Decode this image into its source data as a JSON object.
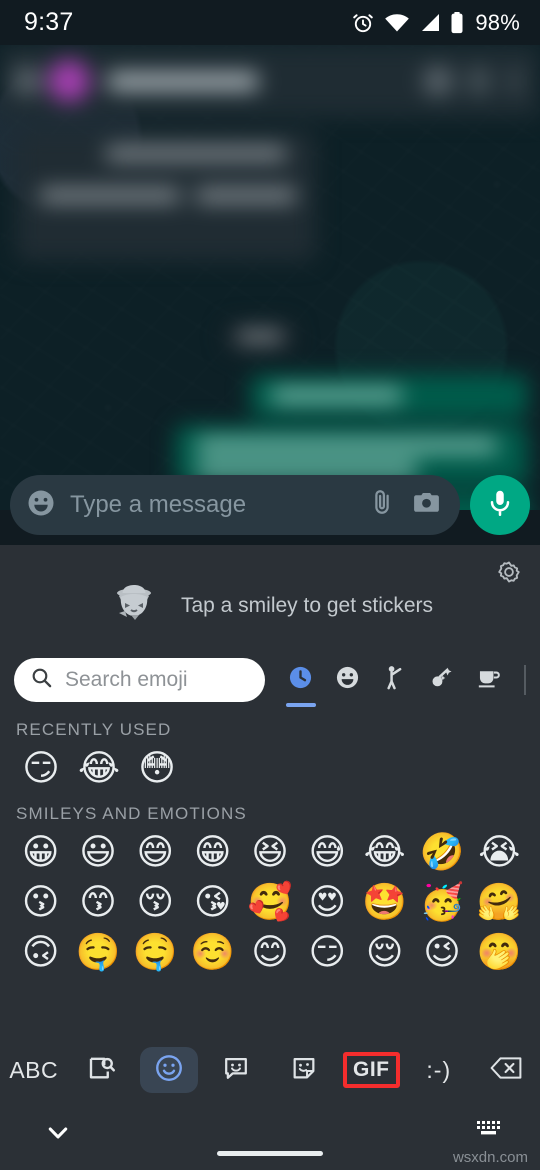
{
  "status_bar": {
    "time": "9:37",
    "battery": "98%",
    "icons": [
      "alarm-icon",
      "wifi-icon",
      "signal-icon",
      "battery-icon"
    ]
  },
  "chat": {
    "header": {
      "back_icon": "back-arrow-icon",
      "avatar": "contact-avatar",
      "contact_name": "",
      "video_call_icon": "video-call-icon",
      "voice_call_icon": "phone-call-icon",
      "menu_icon": "overflow-menu-icon"
    },
    "messages_blurred": true
  },
  "compose": {
    "emoji_icon": "emoji-smiley-icon",
    "placeholder": "Type a message",
    "value": "",
    "attach_icon": "paperclip-icon",
    "camera_icon": "camera-icon",
    "mic_icon": "microphone-icon"
  },
  "sticker_suggestion": {
    "text": "Tap a smiley to get stickers",
    "sticker_icon": "cowboy-cat-sticker",
    "settings_icon": "gear-icon"
  },
  "emoji_panel": {
    "search": {
      "placeholder": "Search emoji",
      "value": "",
      "icon": "search-icon"
    },
    "categories": [
      {
        "name": "recent",
        "icon": "clock-icon",
        "active": true
      },
      {
        "name": "smileys",
        "icon": "smiley-icon",
        "active": false
      },
      {
        "name": "people",
        "icon": "person-waving-icon",
        "active": false
      },
      {
        "name": "animals-nature",
        "icon": "animals-nature-icon",
        "active": false
      },
      {
        "name": "food-drink",
        "icon": "cup-icon",
        "active": false
      }
    ],
    "sections": [
      {
        "title": "RECENTLY USED",
        "emojis": [
          "😏",
          "😂",
          "😳"
        ]
      },
      {
        "title": "SMILEYS AND EMOTIONS",
        "rows": [
          [
            "😀",
            "😃",
            "😄",
            "😁",
            "😆",
            "😅",
            "😂",
            "🤣",
            "😭"
          ],
          [
            "😗",
            "😙",
            "😚",
            "😘",
            "🥰",
            "😍",
            "🤩",
            "🥳",
            "🤗"
          ],
          [
            "🙃",
            "🤤",
            "🤤",
            "☺️",
            "😊",
            "😏",
            "😌",
            "😉",
            "🤭"
          ]
        ]
      }
    ]
  },
  "keyboard_toolbar": {
    "items": [
      {
        "name": "abc-button",
        "label": "ABC",
        "icon": "text-abc",
        "active": false,
        "highlighted": false
      },
      {
        "name": "image-search-button",
        "label": "",
        "icon": "image-search-icon",
        "active": false,
        "highlighted": false
      },
      {
        "name": "emoji-button",
        "label": "",
        "icon": "emoji-smiley-icon",
        "active": true,
        "highlighted": false
      },
      {
        "name": "emoji-kitchen-button",
        "label": "",
        "icon": "sticker-bubble-icon",
        "active": false,
        "highlighted": false
      },
      {
        "name": "stickers-button",
        "label": "",
        "icon": "sticker-square-icon",
        "active": false,
        "highlighted": false
      },
      {
        "name": "gif-button",
        "label": "GIF",
        "icon": "gif-icon",
        "active": false,
        "highlighted": true
      },
      {
        "name": "emoticon-button",
        "label": ":-)",
        "icon": "emoticon-text-icon",
        "active": false,
        "highlighted": false
      },
      {
        "name": "backspace-button",
        "label": "",
        "icon": "backspace-icon",
        "active": false,
        "highlighted": false
      }
    ],
    "highlight_color": "#f42d2d"
  },
  "navigation_bar": {
    "back_icon": "chevron-down-icon",
    "keyboard_icon": "keyboard-icon",
    "home_indicator": "home-pill"
  },
  "watermark": {
    "text": "wsxdn.com"
  },
  "colors": {
    "accent_green": "#00a884",
    "outgoing_bubble": "#005c4b",
    "panel_bg": "#2b3036",
    "active_tab": "#7aa4f0",
    "highlight_red": "#f42d2d"
  }
}
